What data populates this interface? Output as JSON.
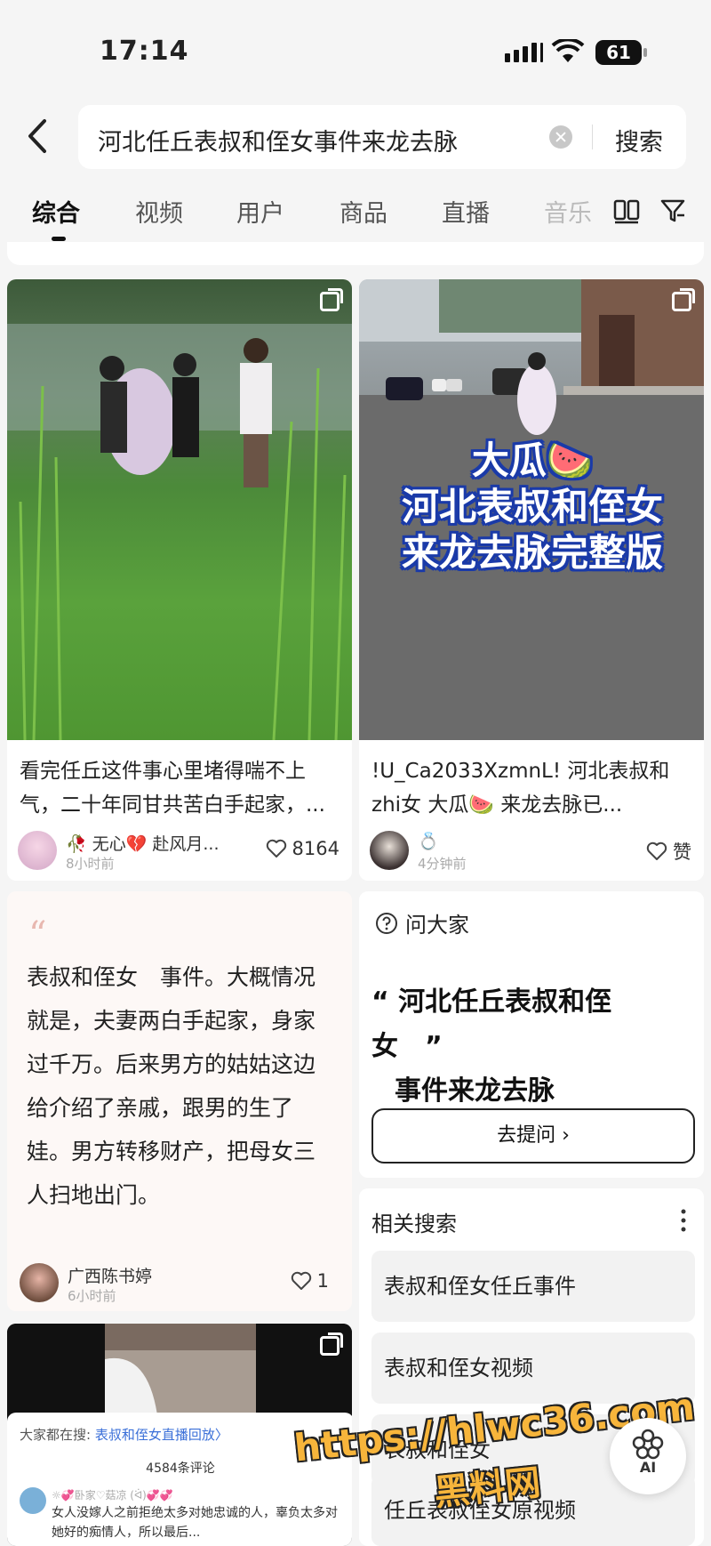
{
  "status_bar": {
    "time": "17:14",
    "battery": "61"
  },
  "search": {
    "query": "河北任丘表叔和侄女事件来龙去脉",
    "submit_label": "搜索"
  },
  "tabs": [
    {
      "label": "综合",
      "active": true
    },
    {
      "label": "视频"
    },
    {
      "label": "用户"
    },
    {
      "label": "商品"
    },
    {
      "label": "直播"
    },
    {
      "label": "音乐"
    }
  ],
  "feed_left": {
    "card1": {
      "title": "看完任丘这件事心里堵得喘不上气，二十年同甘共苦白手起家，...",
      "author": "🥀 无心💔 赴风月...",
      "time": "8小时前",
      "likes": "8164"
    },
    "quote_card": {
      "body": "表叔和侄女　事件。大概情况就是，夫妻两白手起家，身家过千万。后来男方的姑姑这边给介绍了亲戚，跟男的生了娃。男方转移财产，把母女三人扫地出门。",
      "author": "广西陈书婷",
      "time": "6小时前",
      "likes": "1"
    },
    "card3": {
      "popup_prefix": "大家都在搜: ",
      "popup_link": "表叔和侄女直播回放〉",
      "comment_count": "4584条评论",
      "comment_user": "☼💞卧家♡菇凉 (ᐛ)💞💞",
      "comment_text": "女人没嫁人之前拒绝太多对她忠诚的人，辜负太多对她好的痴情人，所以最后..."
    }
  },
  "feed_right": {
    "card2": {
      "overlay_line1": "大瓜🍉",
      "overlay_line2": "河北表叔和侄女",
      "overlay_line3": "来龙去脉完整版",
      "title": "!U_Ca2033XzmnL! 河北表叔和zhi女 大瓜🍉 来龙去脉已...",
      "author": "💍",
      "time": "4分钟前",
      "likes": "赞"
    },
    "ask_card": {
      "label": "问大家",
      "question_line1": "“ 河北任丘表叔和侄女　”",
      "question_line2": "事件来龙去脉",
      "button": "去提问 ›"
    },
    "related": {
      "title": "相关搜索",
      "items": [
        "表叔和侄女任丘事件",
        "表叔和侄女视频",
        "表叔和侄女",
        "任丘表叔侄女原视频"
      ]
    }
  },
  "watermark": {
    "line1": "https://hlwc36.com",
    "line2": "黑料网"
  },
  "ai_button": "AI"
}
